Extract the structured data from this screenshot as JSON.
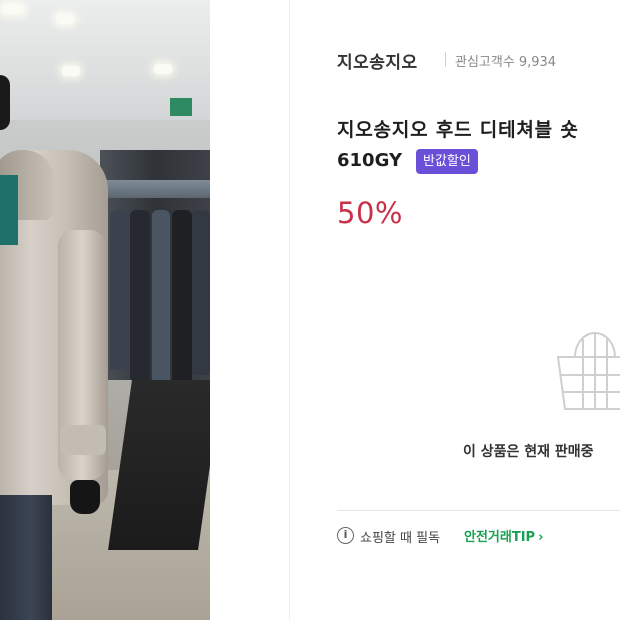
{
  "product": {
    "brand": "지오송지오",
    "watchers_label": "관심고객수",
    "watchers_count": "9,934",
    "title": "지오송지오 후드 디테쳐블 숏",
    "model_code": "610GY",
    "badge": "반값할인",
    "discount": "50%",
    "soldout_icon": "shopping-basket-icon",
    "soldout_message": "이 상품은 현재 판매중"
  },
  "tip": {
    "info_icon": "info-icon",
    "label": "쇼핑할 때 필독",
    "link_label": "안전거래TIP",
    "link_chevron": "›"
  },
  "colors": {
    "discount": "#c9304a",
    "badge": "#6a4fd8",
    "tip_link": "#18a152"
  }
}
